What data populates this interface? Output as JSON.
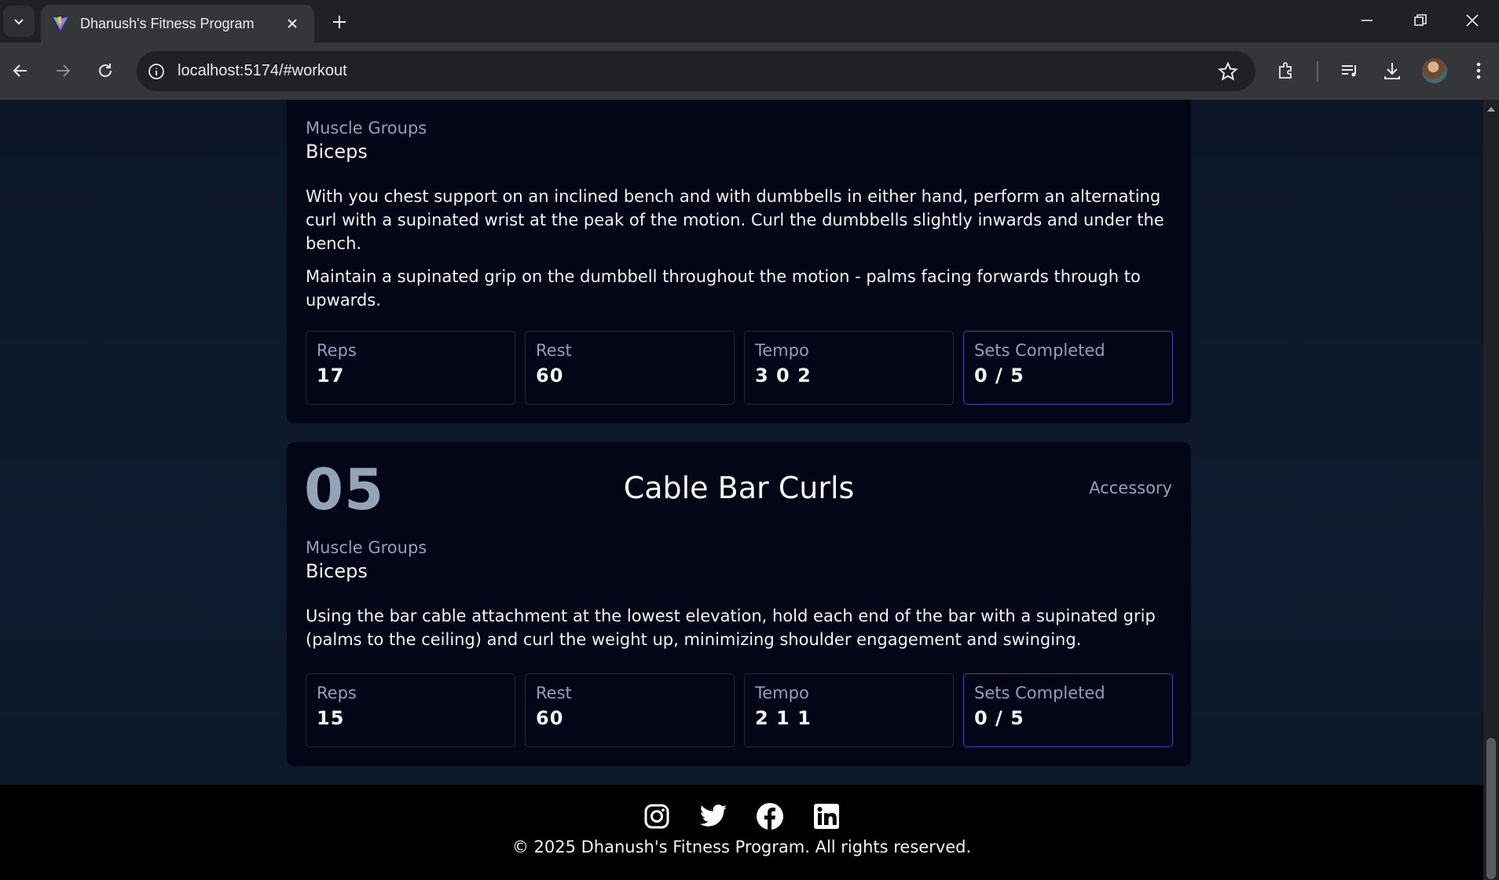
{
  "browser": {
    "tab_title": "Dhanush's Fitness Program",
    "url": "localhost:5174/#workout"
  },
  "exercises": [
    {
      "muscle_groups_label": "Muscle Groups",
      "muscle_groups": "Biceps",
      "description": [
        "With you chest support on an inclined bench and with dumbbells in either hand, perform an alternating curl with a supinated wrist at the peak of the motion. Curl the dumbbells slightly inwards and under the bench.",
        "Maintain a supinated grip on the dumbbell throughout the motion - palms facing forwards through to upwards."
      ],
      "stats": [
        {
          "label": "Reps",
          "value": "17"
        },
        {
          "label": "Rest",
          "value": "60"
        },
        {
          "label": "Tempo",
          "value": "3 0 2"
        },
        {
          "label": "Sets Completed",
          "value": "0 / 5"
        }
      ]
    },
    {
      "number": "05",
      "name": "Cable Bar Curls",
      "type": "Accessory",
      "muscle_groups_label": "Muscle Groups",
      "muscle_groups": "Biceps",
      "description": [
        "Using the bar cable attachment at the lowest elevation, hold each end of the bar with a supinated grip (palms to the ceiling) and curl the weight up, minimizing shoulder engagement and swinging."
      ],
      "stats": [
        {
          "label": "Reps",
          "value": "15"
        },
        {
          "label": "Rest",
          "value": "60"
        },
        {
          "label": "Tempo",
          "value": "2 1 1"
        },
        {
          "label": "Sets Completed",
          "value": "0 / 5"
        }
      ]
    }
  ],
  "footer": {
    "social_icons": [
      "instagram-icon",
      "twitter-icon",
      "facebook-icon",
      "linkedin-icon"
    ],
    "copyright": "© 2025 Dhanush's Fitness Program. All rights reserved."
  },
  "colors": {
    "page_bg": "#0c1628",
    "card_bg": "#020617",
    "muted_text": "#8fa0bd",
    "active_border": "#2f4fb8",
    "footer_bg": "#000000"
  }
}
